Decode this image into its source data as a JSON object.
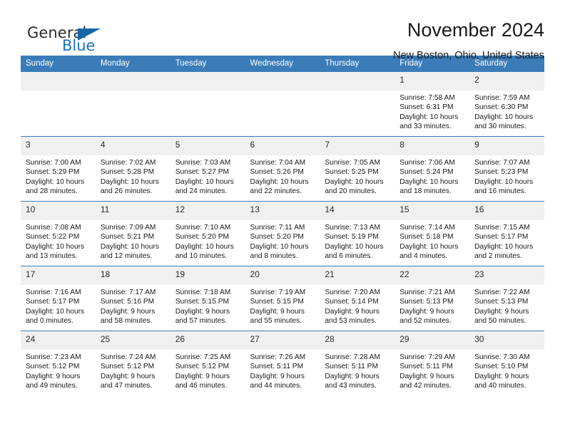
{
  "brand": {
    "name_part1": "General",
    "name_part2": "Blue"
  },
  "header": {
    "title": "November 2024",
    "subtitle": "New Boston, Ohio, United States"
  },
  "colors": {
    "header_blue": "#3b7cb8",
    "logo_blue": "#1e73be",
    "daynum_band": "#f0f0f0"
  },
  "weekday_headers": [
    "Sunday",
    "Monday",
    "Tuesday",
    "Wednesday",
    "Thursday",
    "Friday",
    "Saturday"
  ],
  "weeks": [
    [
      {
        "day": "",
        "sunrise": "",
        "sunset": "",
        "daylight": "",
        "empty": true
      },
      {
        "day": "",
        "sunrise": "",
        "sunset": "",
        "daylight": "",
        "empty": true
      },
      {
        "day": "",
        "sunrise": "",
        "sunset": "",
        "daylight": "",
        "empty": true
      },
      {
        "day": "",
        "sunrise": "",
        "sunset": "",
        "daylight": "",
        "empty": true
      },
      {
        "day": "",
        "sunrise": "",
        "sunset": "",
        "daylight": "",
        "empty": true
      },
      {
        "day": "1",
        "sunrise": "Sunrise: 7:58 AM",
        "sunset": "Sunset: 6:31 PM",
        "daylight": "Daylight: 10 hours and 33 minutes."
      },
      {
        "day": "2",
        "sunrise": "Sunrise: 7:59 AM",
        "sunset": "Sunset: 6:30 PM",
        "daylight": "Daylight: 10 hours and 30 minutes."
      }
    ],
    [
      {
        "day": "3",
        "sunrise": "Sunrise: 7:00 AM",
        "sunset": "Sunset: 5:29 PM",
        "daylight": "Daylight: 10 hours and 28 minutes."
      },
      {
        "day": "4",
        "sunrise": "Sunrise: 7:02 AM",
        "sunset": "Sunset: 5:28 PM",
        "daylight": "Daylight: 10 hours and 26 minutes."
      },
      {
        "day": "5",
        "sunrise": "Sunrise: 7:03 AM",
        "sunset": "Sunset: 5:27 PM",
        "daylight": "Daylight: 10 hours and 24 minutes."
      },
      {
        "day": "6",
        "sunrise": "Sunrise: 7:04 AM",
        "sunset": "Sunset: 5:26 PM",
        "daylight": "Daylight: 10 hours and 22 minutes."
      },
      {
        "day": "7",
        "sunrise": "Sunrise: 7:05 AM",
        "sunset": "Sunset: 5:25 PM",
        "daylight": "Daylight: 10 hours and 20 minutes."
      },
      {
        "day": "8",
        "sunrise": "Sunrise: 7:06 AM",
        "sunset": "Sunset: 5:24 PM",
        "daylight": "Daylight: 10 hours and 18 minutes."
      },
      {
        "day": "9",
        "sunrise": "Sunrise: 7:07 AM",
        "sunset": "Sunset: 5:23 PM",
        "daylight": "Daylight: 10 hours and 16 minutes."
      }
    ],
    [
      {
        "day": "10",
        "sunrise": "Sunrise: 7:08 AM",
        "sunset": "Sunset: 5:22 PM",
        "daylight": "Daylight: 10 hours and 13 minutes."
      },
      {
        "day": "11",
        "sunrise": "Sunrise: 7:09 AM",
        "sunset": "Sunset: 5:21 PM",
        "daylight": "Daylight: 10 hours and 12 minutes."
      },
      {
        "day": "12",
        "sunrise": "Sunrise: 7:10 AM",
        "sunset": "Sunset: 5:20 PM",
        "daylight": "Daylight: 10 hours and 10 minutes."
      },
      {
        "day": "13",
        "sunrise": "Sunrise: 7:11 AM",
        "sunset": "Sunset: 5:20 PM",
        "daylight": "Daylight: 10 hours and 8 minutes."
      },
      {
        "day": "14",
        "sunrise": "Sunrise: 7:13 AM",
        "sunset": "Sunset: 5:19 PM",
        "daylight": "Daylight: 10 hours and 6 minutes."
      },
      {
        "day": "15",
        "sunrise": "Sunrise: 7:14 AM",
        "sunset": "Sunset: 5:18 PM",
        "daylight": "Daylight: 10 hours and 4 minutes."
      },
      {
        "day": "16",
        "sunrise": "Sunrise: 7:15 AM",
        "sunset": "Sunset: 5:17 PM",
        "daylight": "Daylight: 10 hours and 2 minutes."
      }
    ],
    [
      {
        "day": "17",
        "sunrise": "Sunrise: 7:16 AM",
        "sunset": "Sunset: 5:17 PM",
        "daylight": "Daylight: 10 hours and 0 minutes."
      },
      {
        "day": "18",
        "sunrise": "Sunrise: 7:17 AM",
        "sunset": "Sunset: 5:16 PM",
        "daylight": "Daylight: 9 hours and 58 minutes."
      },
      {
        "day": "19",
        "sunrise": "Sunrise: 7:18 AM",
        "sunset": "Sunset: 5:15 PM",
        "daylight": "Daylight: 9 hours and 57 minutes."
      },
      {
        "day": "20",
        "sunrise": "Sunrise: 7:19 AM",
        "sunset": "Sunset: 5:15 PM",
        "daylight": "Daylight: 9 hours and 55 minutes."
      },
      {
        "day": "21",
        "sunrise": "Sunrise: 7:20 AM",
        "sunset": "Sunset: 5:14 PM",
        "daylight": "Daylight: 9 hours and 53 minutes."
      },
      {
        "day": "22",
        "sunrise": "Sunrise: 7:21 AM",
        "sunset": "Sunset: 5:13 PM",
        "daylight": "Daylight: 9 hours and 52 minutes."
      },
      {
        "day": "23",
        "sunrise": "Sunrise: 7:22 AM",
        "sunset": "Sunset: 5:13 PM",
        "daylight": "Daylight: 9 hours and 50 minutes."
      }
    ],
    [
      {
        "day": "24",
        "sunrise": "Sunrise: 7:23 AM",
        "sunset": "Sunset: 5:12 PM",
        "daylight": "Daylight: 9 hours and 49 minutes."
      },
      {
        "day": "25",
        "sunrise": "Sunrise: 7:24 AM",
        "sunset": "Sunset: 5:12 PM",
        "daylight": "Daylight: 9 hours and 47 minutes."
      },
      {
        "day": "26",
        "sunrise": "Sunrise: 7:25 AM",
        "sunset": "Sunset: 5:12 PM",
        "daylight": "Daylight: 9 hours and 46 minutes."
      },
      {
        "day": "27",
        "sunrise": "Sunrise: 7:26 AM",
        "sunset": "Sunset: 5:11 PM",
        "daylight": "Daylight: 9 hours and 44 minutes."
      },
      {
        "day": "28",
        "sunrise": "Sunrise: 7:28 AM",
        "sunset": "Sunset: 5:11 PM",
        "daylight": "Daylight: 9 hours and 43 minutes."
      },
      {
        "day": "29",
        "sunrise": "Sunrise: 7:29 AM",
        "sunset": "Sunset: 5:11 PM",
        "daylight": "Daylight: 9 hours and 42 minutes."
      },
      {
        "day": "30",
        "sunrise": "Sunrise: 7:30 AM",
        "sunset": "Sunset: 5:10 PM",
        "daylight": "Daylight: 9 hours and 40 minutes."
      }
    ]
  ]
}
